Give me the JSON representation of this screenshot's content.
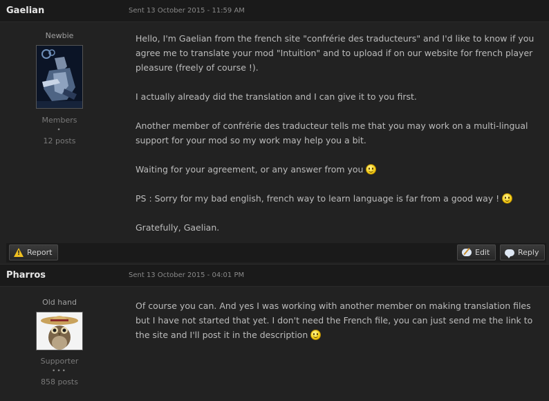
{
  "posts": [
    {
      "author": "Gaelian",
      "sent": "Sent 13 October 2015 - 11:59 AM",
      "rank": "Newbie",
      "group": "Members",
      "pips": "•",
      "post_count": "12 posts",
      "paragraphs": [
        "Hello, I'm Gaelian from the french site \"confrérie des traducteurs\" and I'd like to know if you agree me to translate your mod \"Intuition\" and to upload if on our website for french player pleasure (freely of course !).",
        "I actually already did the translation  and I can give it to you first.",
        "Another member of confrérie des traducteur tells me that you may work on a multi-lingual support for your mod so my work may help you a bit.",
        "Waiting for your agreement, or any answer from you",
        "PS : Sorry for my bad english, french way to learn language is  far from a good way !",
        "Gratefully, Gaelian."
      ],
      "actions": {
        "report": "Report",
        "edit": "Edit",
        "reply": "Reply"
      }
    },
    {
      "author": "Pharros",
      "sent": "Sent 13 October 2015 - 04:01 PM",
      "rank": "Old hand",
      "group": "Supporter",
      "pips": "•••",
      "post_count": "858 posts",
      "paragraphs": [
        "Of course you can. And yes I was working with another member on making translation files but I have not started that yet. I don't need the French file, you can just send me the link to the site and I'll post it in the description"
      ]
    }
  ],
  "icons": {
    "smiley": "smiley-icon",
    "wink": "wink-smiley-icon",
    "report": "warning-icon",
    "edit": "edit-bubble-icon",
    "reply": "reply-bubble-icon"
  },
  "colors": {
    "background": "#1c1c1c",
    "post_body": "#222222",
    "header": "#1a1a1a",
    "text": "#bcbcbc",
    "author": "#e6e6e6",
    "warning": "#f0c020"
  }
}
